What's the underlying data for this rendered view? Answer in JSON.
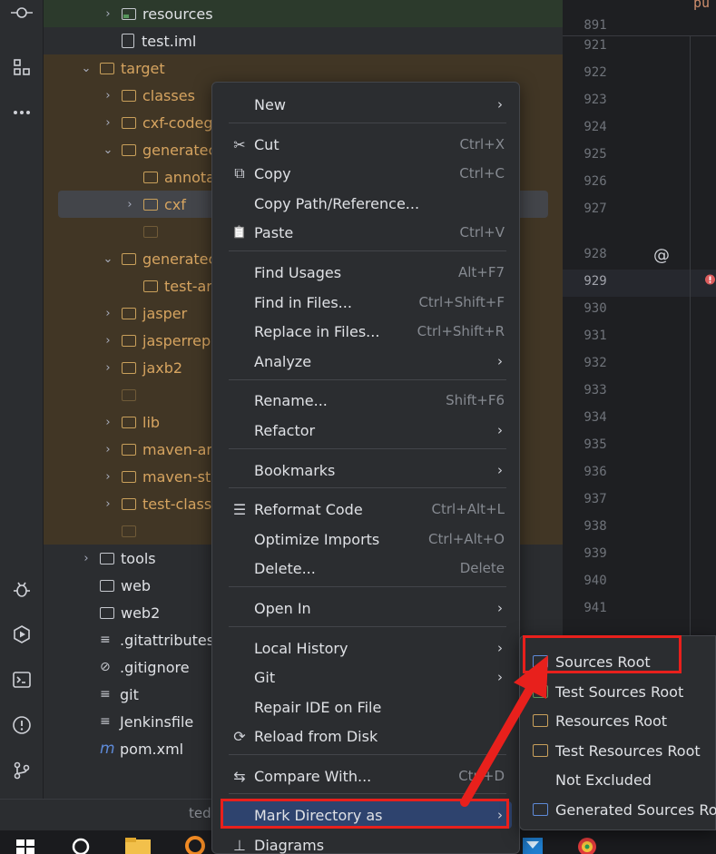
{
  "tree": {
    "rows": [
      {
        "label": "resources",
        "indent": 2,
        "arrow": "›",
        "icon": "res"
      },
      {
        "label": "test.iml",
        "indent": 2,
        "arrow": "",
        "icon": "file"
      },
      {
        "label": "target",
        "indent": 1,
        "arrow": "⌄",
        "icon": "folder"
      },
      {
        "label": "classes",
        "indent": 2,
        "arrow": "›",
        "icon": "folder"
      },
      {
        "label": "cxf-codeg",
        "indent": 2,
        "arrow": "›",
        "icon": "folder"
      },
      {
        "label": "generatec",
        "indent": 2,
        "arrow": "⌄",
        "icon": "folder"
      },
      {
        "label": "annota",
        "indent": 3,
        "arrow": "",
        "icon": "folder"
      },
      {
        "label": "cxf",
        "indent": 3,
        "arrow": "›",
        "icon": "folder"
      },
      {
        "label": "",
        "indent": 3,
        "arrow": "",
        "icon": "none"
      },
      {
        "label": "generatec",
        "indent": 2,
        "arrow": "⌄",
        "icon": "folder"
      },
      {
        "label": "test-ar",
        "indent": 3,
        "arrow": "",
        "icon": "folder"
      },
      {
        "label": "jasper",
        "indent": 2,
        "arrow": "›",
        "icon": "folder"
      },
      {
        "label": "jasperrepo",
        "indent": 2,
        "arrow": "›",
        "icon": "folder"
      },
      {
        "label": "jaxb2",
        "indent": 2,
        "arrow": "›",
        "icon": "folder"
      },
      {
        "label": "",
        "indent": 2,
        "arrow": "",
        "icon": "none"
      },
      {
        "label": "lib",
        "indent": 2,
        "arrow": "›",
        "icon": "folder"
      },
      {
        "label": "maven-ar",
        "indent": 2,
        "arrow": "›",
        "icon": "folder"
      },
      {
        "label": "maven-st",
        "indent": 2,
        "arrow": "›",
        "icon": "folder"
      },
      {
        "label": "test-classe",
        "indent": 2,
        "arrow": "›",
        "icon": "folder"
      },
      {
        "label": "",
        "indent": 2,
        "arrow": "",
        "icon": "none"
      },
      {
        "label": "tools",
        "indent": 1,
        "arrow": "›",
        "icon": "gray"
      },
      {
        "label": "web",
        "indent": 1,
        "arrow": "",
        "icon": "gray"
      },
      {
        "label": "web2",
        "indent": 1,
        "arrow": "",
        "icon": "gray"
      },
      {
        "label": ".gitattributes",
        "indent": 1,
        "arrow": "",
        "icon": "lines"
      },
      {
        "label": ".gitignore",
        "indent": 1,
        "arrow": "",
        "icon": "ignore"
      },
      {
        "label": "git",
        "indent": 1,
        "arrow": "",
        "icon": "lines"
      },
      {
        "label": "Jenkinsfile",
        "indent": 1,
        "arrow": "",
        "icon": "lines"
      },
      {
        "label": "pom.xml",
        "indent": 1,
        "arrow": "",
        "icon": "maven"
      }
    ]
  },
  "gutter": {
    "lines": [
      "891",
      "921",
      "922",
      "923",
      "924",
      "925",
      "926",
      "927",
      "928",
      "929",
      "930",
      "931",
      "932",
      "933",
      "934",
      "935",
      "936",
      "937",
      "938",
      "939",
      "940",
      "941"
    ],
    "current": "929",
    "at_marker": "@",
    "top_fragment": "pu"
  },
  "menu": {
    "items": [
      {
        "label": "New",
        "shortcut": "",
        "submenu": true,
        "icon": ""
      },
      {
        "label": "Cut",
        "shortcut": "Ctrl+X",
        "submenu": false,
        "icon": "✂"
      },
      {
        "label": "Copy",
        "shortcut": "Ctrl+C",
        "submenu": false,
        "icon": "⧉"
      },
      {
        "label": "Copy Path/Reference...",
        "shortcut": "",
        "submenu": false,
        "icon": ""
      },
      {
        "label": "Paste",
        "shortcut": "Ctrl+V",
        "submenu": false,
        "icon": "📋"
      },
      {
        "label": "Find Usages",
        "shortcut": "Alt+F7",
        "submenu": false,
        "icon": ""
      },
      {
        "label": "Find in Files...",
        "shortcut": "Ctrl+Shift+F",
        "submenu": false,
        "icon": ""
      },
      {
        "label": "Replace in Files...",
        "shortcut": "Ctrl+Shift+R",
        "submenu": false,
        "icon": ""
      },
      {
        "label": "Analyze",
        "shortcut": "",
        "submenu": true,
        "icon": ""
      },
      {
        "label": "Rename...",
        "shortcut": "Shift+F6",
        "submenu": false,
        "icon": ""
      },
      {
        "label": "Refactor",
        "shortcut": "",
        "submenu": true,
        "icon": ""
      },
      {
        "label": "Bookmarks",
        "shortcut": "",
        "submenu": true,
        "icon": ""
      },
      {
        "label": "Reformat Code",
        "shortcut": "Ctrl+Alt+L",
        "submenu": false,
        "icon": "☰"
      },
      {
        "label": "Optimize Imports",
        "shortcut": "Ctrl+Alt+O",
        "submenu": false,
        "icon": ""
      },
      {
        "label": "Delete...",
        "shortcut": "Delete",
        "submenu": false,
        "icon": ""
      },
      {
        "label": "Open In",
        "shortcut": "",
        "submenu": true,
        "icon": ""
      },
      {
        "label": "Local History",
        "shortcut": "",
        "submenu": true,
        "icon": ""
      },
      {
        "label": "Git",
        "shortcut": "",
        "submenu": true,
        "icon": ""
      },
      {
        "label": "Repair IDE on File",
        "shortcut": "",
        "submenu": false,
        "icon": ""
      },
      {
        "label": "Reload from Disk",
        "shortcut": "",
        "submenu": false,
        "icon": "⟳"
      },
      {
        "label": "Compare With...",
        "shortcut": "Ctrl+D",
        "submenu": false,
        "icon": "⇆"
      },
      {
        "label": "Mark Directory as",
        "shortcut": "",
        "submenu": true,
        "icon": ""
      },
      {
        "label": "Diagrams",
        "shortcut": "",
        "submenu": false,
        "icon": "⊥"
      }
    ],
    "submenu_arrow": "›"
  },
  "submenu": {
    "items": [
      {
        "label": "Sources Root",
        "icon": "blue"
      },
      {
        "label": "Test Sources Root",
        "icon": "green"
      },
      {
        "label": "Resources Root",
        "icon": "tan"
      },
      {
        "label": "Test Resources Root",
        "icon": "tan"
      },
      {
        "label": "Not Excluded",
        "icon": "none"
      },
      {
        "label": "Generated Sources Root",
        "icon": "blue"
      }
    ]
  },
  "status": {
    "text": "ted"
  },
  "colors": {
    "accent": "#2e436e",
    "annotation": "#e8201c",
    "folder": "#c9a05b"
  }
}
